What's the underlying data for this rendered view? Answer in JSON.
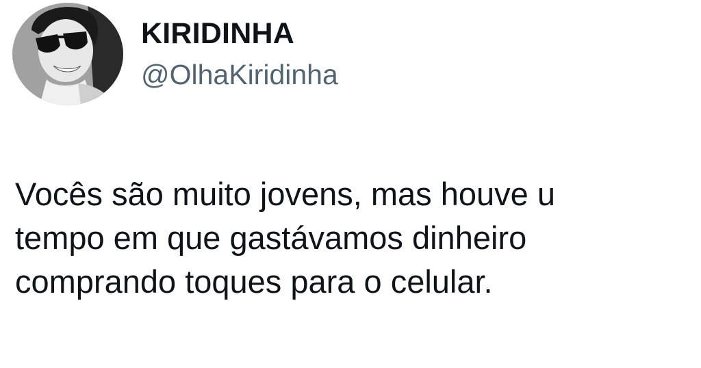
{
  "author": {
    "display_name": "KIRIDINHA",
    "handle": "@OlhaKiridinha",
    "avatar_icon": "profile-photo"
  },
  "tweet": {
    "lines": [
      "Vocês são muito jovens, mas houve u",
      "tempo em que gastávamos dinheiro",
      "comprando toques para o celular."
    ]
  },
  "colors": {
    "background": "#ffffff",
    "text": "#0f1419",
    "handle": "#536471"
  }
}
